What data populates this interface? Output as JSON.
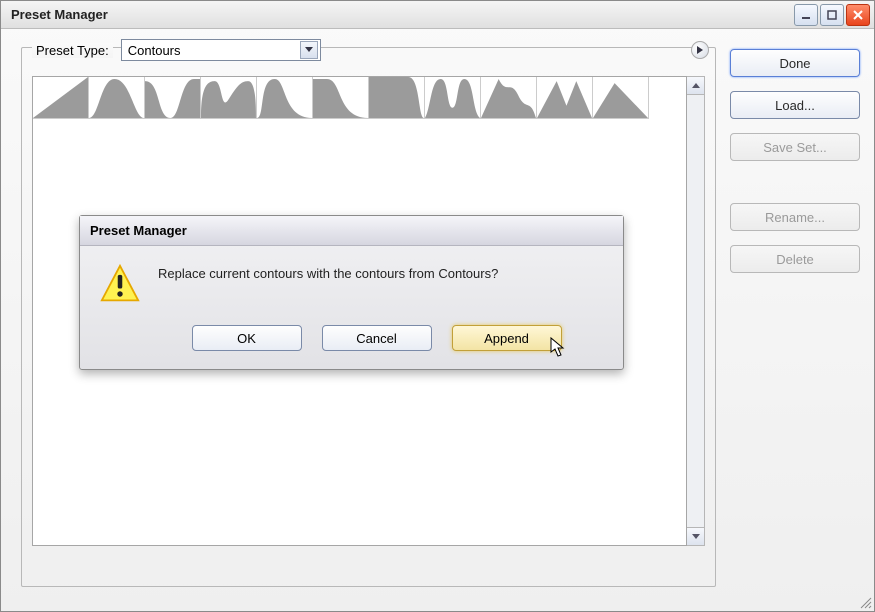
{
  "window": {
    "title": "Preset Manager"
  },
  "preset_type": {
    "label": "Preset Type:",
    "value": "Contours"
  },
  "sidebar": {
    "done": "Done",
    "load": "Load...",
    "save_set": "Save Set...",
    "rename": "Rename...",
    "delete": "Delete"
  },
  "dialog": {
    "title": "Preset Manager",
    "message": "Replace current contours with the contours from Contours?",
    "ok": "OK",
    "cancel": "Cancel",
    "append": "Append"
  },
  "contour_shapes": [
    "M0 40 L56 0 L56 40 Z",
    "M0 40 C10 40 12 2 26 2 C42 2 46 40 56 40 Z",
    "M0 40 L0 4 C16 4 12 40 26 40 C36 40 36 2 50 2 L56 2 L56 40 Z",
    "M0 40 C0 10 6 4 14 4 C22 4 20 34 28 22 C36 10 40 4 48 4 C56 4 56 30 56 40 Z",
    "M0 40 C8 40 2 2 18 2 C30 2 26 40 56 40 Z",
    "M0 40 L0 2 L14 2 C30 2 24 40 56 40 Z",
    "M0 40 L0 0 L40 0 C52 0 50 40 56 40 Z",
    "M0 40 C6 30 6 2 16 2 C24 2 22 30 28 30 C34 30 32 2 40 2 C50 2 48 34 56 40 Z",
    "M0 40 L18 2 C26 18 30 2 38 18 C46 34 50 20 56 40 Z",
    "M0 40 L20 4 L30 28 L40 4 L56 40 Z",
    "M0 40 L22 6 L56 40 Z"
  ]
}
